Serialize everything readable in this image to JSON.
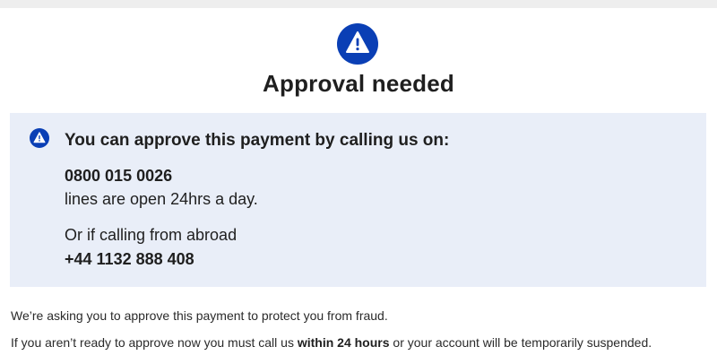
{
  "colors": {
    "accent_blue": "#0a3fb5",
    "notice_background": "#e9eef8",
    "top_strip": "#eeeeee"
  },
  "header": {
    "icon": "warning-triangle-icon",
    "title": "Approval needed"
  },
  "notice": {
    "icon": "warning-triangle-icon",
    "heading": "You can approve this payment by calling us on:",
    "phone": "0800 015 0026",
    "hours": "lines are open 24hrs a day.",
    "abroad_text": "Or if calling from abroad",
    "international_phone": "+44 1132 888 408"
  },
  "body": {
    "fraud_text": "We’re asking you to approve this payment to protect you from fraud.",
    "deadline_prefix": "If you aren’t ready to approve now you must call us ",
    "deadline_bold": "within 24 hours",
    "deadline_suffix": " or your account will be temporarily suspended."
  }
}
